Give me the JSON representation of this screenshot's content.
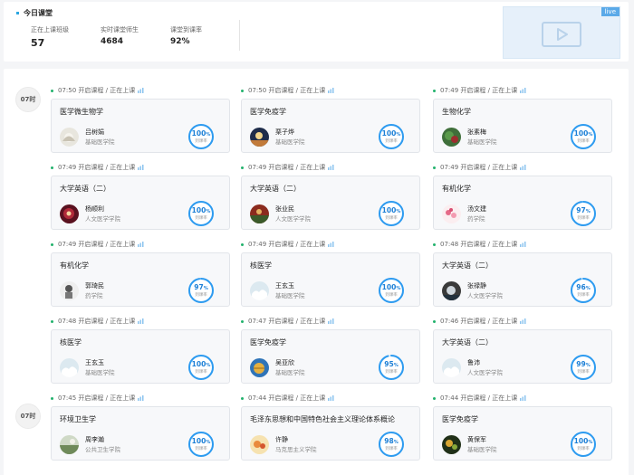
{
  "header": {
    "title": "今日课堂",
    "stats": [
      {
        "label": "正在上课班级",
        "value": "57"
      },
      {
        "label": "实时课堂师生",
        "value": "4684"
      },
      {
        "label": "课堂到课率",
        "value": "92%"
      }
    ],
    "live_tag": "live"
  },
  "rate_label": "到课率",
  "time_badges": [
    "07时",
    "07时"
  ],
  "courses": [
    {
      "time": "07:50",
      "status": "开启课程 / 正在上课",
      "course": "医学微生物学",
      "teacher": "吕树娟",
      "school": "基础医学院",
      "rate": 100,
      "avatar": "a1"
    },
    {
      "time": "07:50",
      "status": "开启课程 / 正在上课",
      "course": "医学免疫学",
      "teacher": "栗子烨",
      "school": "基础医学院",
      "rate": 100,
      "avatar": "a2"
    },
    {
      "time": "07:49",
      "status": "开启课程 / 正在上课",
      "course": "生物化学",
      "teacher": "张素梅",
      "school": "基础医学院",
      "rate": 100,
      "avatar": "a3"
    },
    {
      "time": "07:49",
      "status": "开启课程 / 正在上课",
      "course": "大学英语（二）",
      "teacher": "杨顺利",
      "school": "人文医学学院",
      "rate": 100,
      "avatar": "a4"
    },
    {
      "time": "07:49",
      "status": "开启课程 / 正在上课",
      "course": "大学英语（二）",
      "teacher": "张业民",
      "school": "人文医学学院",
      "rate": 100,
      "avatar": "a5"
    },
    {
      "time": "07:49",
      "status": "开启课程 / 正在上课",
      "course": "有机化学",
      "teacher": "汤文建",
      "school": "药学院",
      "rate": 97,
      "avatar": "a6"
    },
    {
      "time": "07:49",
      "status": "开启课程 / 正在上课",
      "course": "有机化学",
      "teacher": "郭琦民",
      "school": "药学院",
      "rate": 97,
      "avatar": "a7"
    },
    {
      "time": "07:49",
      "status": "开启课程 / 正在上课",
      "course": "核医学",
      "teacher": "王玄玉",
      "school": "基础医学院",
      "rate": 100,
      "avatar": "a8"
    },
    {
      "time": "07:48",
      "status": "开启课程 / 正在上课",
      "course": "大学英语（二）",
      "teacher": "张禄静",
      "school": "人文医学学院",
      "rate": 96,
      "avatar": "a9"
    },
    {
      "time": "07:48",
      "status": "开启课程 / 正在上课",
      "course": "核医学",
      "teacher": "王玄玉",
      "school": "基础医学院",
      "rate": 100,
      "avatar": "a8"
    },
    {
      "time": "07:47",
      "status": "开启课程 / 正在上课",
      "course": "医学免疫学",
      "teacher": "吴亚欣",
      "school": "基础医学院",
      "rate": 95,
      "avatar": "a10"
    },
    {
      "time": "07:46",
      "status": "开启课程 / 正在上课",
      "course": "大学英语（二）",
      "teacher": "鲁沛",
      "school": "人文医学学院",
      "rate": 99,
      "avatar": "a8"
    },
    {
      "time": "07:45",
      "status": "开启课程 / 正在上课",
      "course": "环境卫生学",
      "teacher": "周李瀚",
      "school": "公共卫生学院",
      "rate": 100,
      "avatar": "a11"
    },
    {
      "time": "07:44",
      "status": "开启课程 / 正在上课",
      "course": "毛泽东思想和中国特色社会主义理论体系概论",
      "teacher": "许静",
      "school": "马克思主义学院",
      "rate": 98,
      "avatar": "a12"
    },
    {
      "time": "07:44",
      "status": "开启课程 / 正在上课",
      "course": "医学免疫学",
      "teacher": "黄保军",
      "school": "基础医学院",
      "rate": 100,
      "avatar": "a13"
    }
  ],
  "colors": {
    "accent": "#1c7fd6",
    "ring": "#2d9bf0",
    "live": "#5aa9e8",
    "status_dot": "#23b26d"
  }
}
